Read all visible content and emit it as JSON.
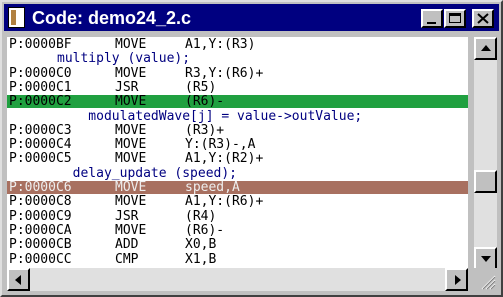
{
  "window": {
    "title": "Code: demo24_2.c"
  },
  "rows": [
    {
      "kind": "code",
      "addr": "P:0000BF",
      "op": "MOVE",
      "arg": "A1,Y:(R3)"
    },
    {
      "kind": "source",
      "text": "multiply (value);"
    },
    {
      "kind": "code",
      "addr": "P:0000C0",
      "op": "MOVE",
      "arg": "R3,Y:(R6)+"
    },
    {
      "kind": "code",
      "addr": "P:0000C1",
      "op": "JSR",
      "arg": "(R5)"
    },
    {
      "kind": "code",
      "addr": "P:0000C2",
      "op": "MOVE",
      "arg": "(R6)-",
      "highlight": "green"
    },
    {
      "kind": "source",
      "text": "    modulatedWave[j] = value->outValue;"
    },
    {
      "kind": "code",
      "addr": "P:0000C3",
      "op": "MOVE",
      "arg": "(R3)+"
    },
    {
      "kind": "code",
      "addr": "P:0000C4",
      "op": "MOVE",
      "arg": "Y:(R3)-,A"
    },
    {
      "kind": "code",
      "addr": "P:0000C5",
      "op": "MOVE",
      "arg": "A1,Y:(R2)+"
    },
    {
      "kind": "source",
      "text": "  delay_update (speed);"
    },
    {
      "kind": "code",
      "addr": "P:0000C6",
      "op": "MOVE",
      "arg": "speed,A",
      "highlight": "brown"
    },
    {
      "kind": "code",
      "addr": "P:0000C8",
      "op": "MOVE",
      "arg": "A1,Y:(R6)+"
    },
    {
      "kind": "code",
      "addr": "P:0000C9",
      "op": "JSR",
      "arg": "(R4)"
    },
    {
      "kind": "code",
      "addr": "P:0000CA",
      "op": "MOVE",
      "arg": "(R6)-"
    },
    {
      "kind": "code",
      "addr": "P:0000CB",
      "op": "ADD",
      "arg": "X0,B"
    },
    {
      "kind": "code",
      "addr": "P:0000CC",
      "op": "CMP",
      "arg": "X1,B"
    }
  ],
  "colors": {
    "title_bar": "#000080",
    "source_text": "#000080",
    "highlight_green": "#20a040",
    "highlight_brown": "#a87060"
  },
  "icons": [
    "document-icon",
    "minimize-icon",
    "maximize-icon",
    "close-icon",
    "scroll-up-icon",
    "scroll-down-icon",
    "scroll-left-icon",
    "scroll-right-icon",
    "size-grip-icon"
  ]
}
